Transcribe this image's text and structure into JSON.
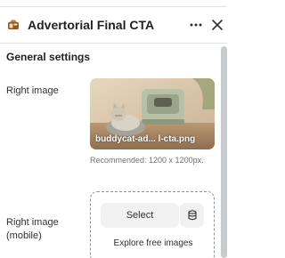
{
  "header": {
    "title": "Advertorial Final CTA",
    "section_icon": "section-block-icon",
    "more_icon": "more-horizontal-icon",
    "close_icon": "close-icon"
  },
  "settings": {
    "section_title": "General settings",
    "right_image": {
      "label": "Right image",
      "filename": "buddycat-ad... l-cta.png",
      "hint": "Recommended: 1200 x 1200px."
    },
    "right_image_mobile": {
      "label": "Right image (mobile)",
      "select_label": "Select",
      "library_icon": "database-icon",
      "explore_label": "Explore free images"
    }
  },
  "colors": {
    "text": "#202223",
    "muted": "#6d7175",
    "button_bg": "#f1f1f1",
    "border": "#8c9196"
  }
}
